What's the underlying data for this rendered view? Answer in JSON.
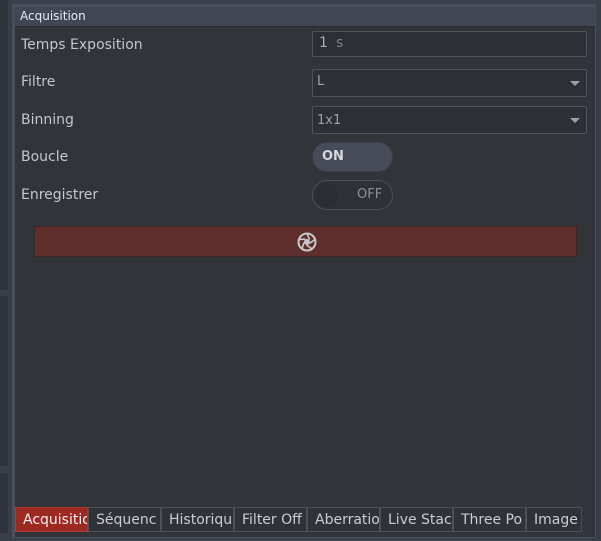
{
  "panel": {
    "title": "Acquisition"
  },
  "exposure": {
    "label": "Temps Exposition",
    "value": "1",
    "unit": "s"
  },
  "filter": {
    "label": "Filtre",
    "value": "L"
  },
  "binning": {
    "label": "Binning",
    "value": "1x1"
  },
  "loop": {
    "label": "Boucle",
    "state": "ON"
  },
  "save": {
    "label": "Enregistrer",
    "state": "OFF"
  },
  "capture_button": {
    "icon": "aperture-icon"
  },
  "tabs": [
    {
      "label": "Acquisitio",
      "active": true
    },
    {
      "label": "Séquenc",
      "active": false
    },
    {
      "label": "Historiqu",
      "active": false
    },
    {
      "label": "Filter Off",
      "active": false
    },
    {
      "label": "Aberratio",
      "active": false
    },
    {
      "label": "Live Stac",
      "active": false
    },
    {
      "label": "Three Po",
      "active": false
    },
    {
      "label": "Image",
      "active": false
    }
  ],
  "colors": {
    "accent": "#9d2a22",
    "capture": "#5e2e2d",
    "panel": "#313439"
  }
}
